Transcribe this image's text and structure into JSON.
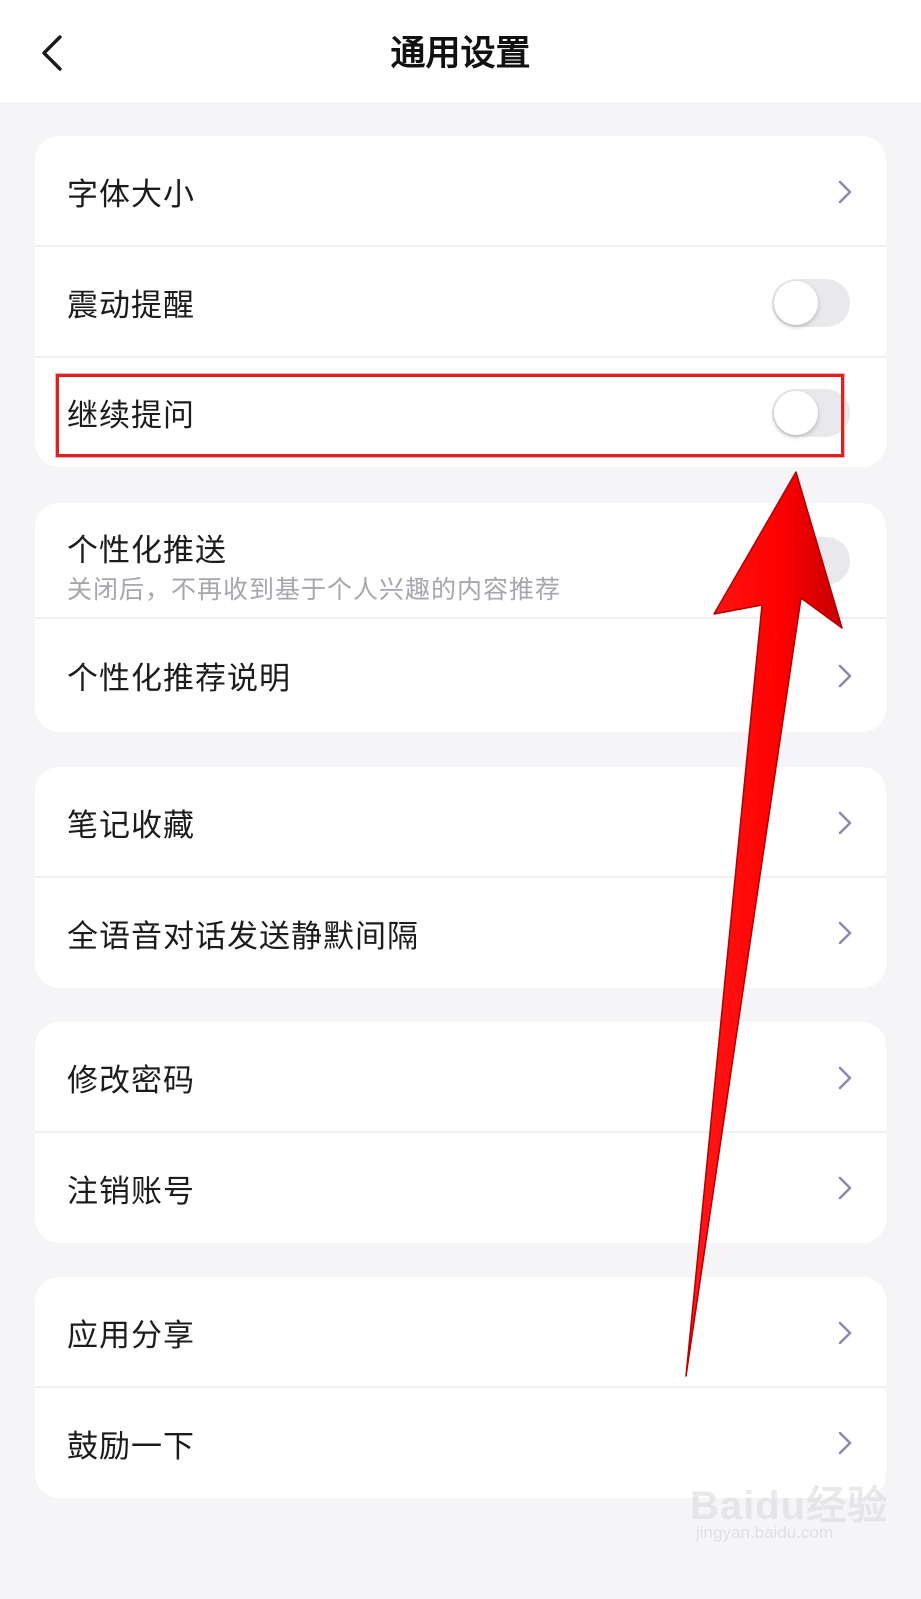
{
  "header": {
    "title": "通用设置",
    "back_icon": "chevron-left-icon"
  },
  "groups": [
    {
      "rows": [
        {
          "label": "字体大小",
          "control": "chevron"
        },
        {
          "label": "震动提醒",
          "control": "toggle",
          "on": false
        },
        {
          "label": "继续提问",
          "control": "toggle",
          "on": false
        }
      ]
    },
    {
      "rows": [
        {
          "label": "个性化推送",
          "sublabel": "关闭后，不再收到基于个人兴趣的内容推荐",
          "control": "toggle",
          "on": false
        },
        {
          "label": "个性化推荐说明",
          "control": "chevron"
        }
      ]
    },
    {
      "rows": [
        {
          "label": "笔记收藏",
          "control": "chevron"
        },
        {
          "label": "全语音对话发送静默间隔",
          "control": "chevron"
        }
      ]
    },
    {
      "rows": [
        {
          "label": "修改密码",
          "control": "chevron"
        },
        {
          "label": "注销账号",
          "control": "chevron"
        }
      ]
    },
    {
      "rows": [
        {
          "label": "应用分享",
          "control": "chevron"
        },
        {
          "label": "鼓励一下",
          "control": "chevron"
        }
      ]
    }
  ],
  "annotation": {
    "highlight_color": "#e02020",
    "arrow_color": "#ff0000"
  },
  "watermark": {
    "brand": "Baidu经验",
    "url": "jingyan.baidu.com"
  },
  "colors": {
    "background": "#f5f5f7",
    "card": "#ffffff",
    "chevron": "#8e8ab0",
    "toggle_off": "#e9e9ec"
  }
}
